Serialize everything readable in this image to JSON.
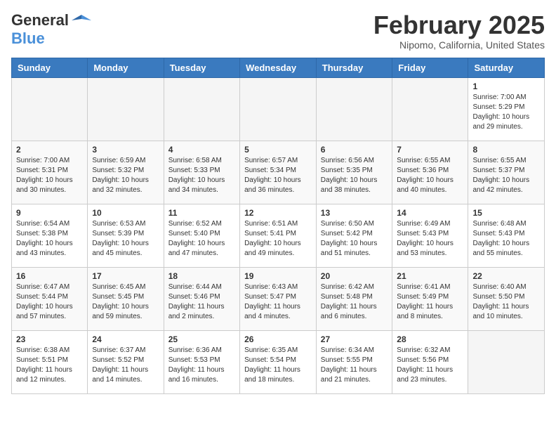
{
  "header": {
    "logo_general": "General",
    "logo_blue": "Blue",
    "month_title": "February 2025",
    "location": "Nipomo, California, United States"
  },
  "weekdays": [
    "Sunday",
    "Monday",
    "Tuesday",
    "Wednesday",
    "Thursday",
    "Friday",
    "Saturday"
  ],
  "weeks": [
    [
      {
        "day": "",
        "info": ""
      },
      {
        "day": "",
        "info": ""
      },
      {
        "day": "",
        "info": ""
      },
      {
        "day": "",
        "info": ""
      },
      {
        "day": "",
        "info": ""
      },
      {
        "day": "",
        "info": ""
      },
      {
        "day": "1",
        "info": "Sunrise: 7:00 AM\nSunset: 5:29 PM\nDaylight: 10 hours and 29 minutes."
      }
    ],
    [
      {
        "day": "2",
        "info": "Sunrise: 7:00 AM\nSunset: 5:31 PM\nDaylight: 10 hours and 30 minutes."
      },
      {
        "day": "3",
        "info": "Sunrise: 6:59 AM\nSunset: 5:32 PM\nDaylight: 10 hours and 32 minutes."
      },
      {
        "day": "4",
        "info": "Sunrise: 6:58 AM\nSunset: 5:33 PM\nDaylight: 10 hours and 34 minutes."
      },
      {
        "day": "5",
        "info": "Sunrise: 6:57 AM\nSunset: 5:34 PM\nDaylight: 10 hours and 36 minutes."
      },
      {
        "day": "6",
        "info": "Sunrise: 6:56 AM\nSunset: 5:35 PM\nDaylight: 10 hours and 38 minutes."
      },
      {
        "day": "7",
        "info": "Sunrise: 6:55 AM\nSunset: 5:36 PM\nDaylight: 10 hours and 40 minutes."
      },
      {
        "day": "8",
        "info": "Sunrise: 6:55 AM\nSunset: 5:37 PM\nDaylight: 10 hours and 42 minutes."
      }
    ],
    [
      {
        "day": "9",
        "info": "Sunrise: 6:54 AM\nSunset: 5:38 PM\nDaylight: 10 hours and 43 minutes."
      },
      {
        "day": "10",
        "info": "Sunrise: 6:53 AM\nSunset: 5:39 PM\nDaylight: 10 hours and 45 minutes."
      },
      {
        "day": "11",
        "info": "Sunrise: 6:52 AM\nSunset: 5:40 PM\nDaylight: 10 hours and 47 minutes."
      },
      {
        "day": "12",
        "info": "Sunrise: 6:51 AM\nSunset: 5:41 PM\nDaylight: 10 hours and 49 minutes."
      },
      {
        "day": "13",
        "info": "Sunrise: 6:50 AM\nSunset: 5:42 PM\nDaylight: 10 hours and 51 minutes."
      },
      {
        "day": "14",
        "info": "Sunrise: 6:49 AM\nSunset: 5:43 PM\nDaylight: 10 hours and 53 minutes."
      },
      {
        "day": "15",
        "info": "Sunrise: 6:48 AM\nSunset: 5:43 PM\nDaylight: 10 hours and 55 minutes."
      }
    ],
    [
      {
        "day": "16",
        "info": "Sunrise: 6:47 AM\nSunset: 5:44 PM\nDaylight: 10 hours and 57 minutes."
      },
      {
        "day": "17",
        "info": "Sunrise: 6:45 AM\nSunset: 5:45 PM\nDaylight: 10 hours and 59 minutes."
      },
      {
        "day": "18",
        "info": "Sunrise: 6:44 AM\nSunset: 5:46 PM\nDaylight: 11 hours and 2 minutes."
      },
      {
        "day": "19",
        "info": "Sunrise: 6:43 AM\nSunset: 5:47 PM\nDaylight: 11 hours and 4 minutes."
      },
      {
        "day": "20",
        "info": "Sunrise: 6:42 AM\nSunset: 5:48 PM\nDaylight: 11 hours and 6 minutes."
      },
      {
        "day": "21",
        "info": "Sunrise: 6:41 AM\nSunset: 5:49 PM\nDaylight: 11 hours and 8 minutes."
      },
      {
        "day": "22",
        "info": "Sunrise: 6:40 AM\nSunset: 5:50 PM\nDaylight: 11 hours and 10 minutes."
      }
    ],
    [
      {
        "day": "23",
        "info": "Sunrise: 6:38 AM\nSunset: 5:51 PM\nDaylight: 11 hours and 12 minutes."
      },
      {
        "day": "24",
        "info": "Sunrise: 6:37 AM\nSunset: 5:52 PM\nDaylight: 11 hours and 14 minutes."
      },
      {
        "day": "25",
        "info": "Sunrise: 6:36 AM\nSunset: 5:53 PM\nDaylight: 11 hours and 16 minutes."
      },
      {
        "day": "26",
        "info": "Sunrise: 6:35 AM\nSunset: 5:54 PM\nDaylight: 11 hours and 18 minutes."
      },
      {
        "day": "27",
        "info": "Sunrise: 6:34 AM\nSunset: 5:55 PM\nDaylight: 11 hours and 21 minutes."
      },
      {
        "day": "28",
        "info": "Sunrise: 6:32 AM\nSunset: 5:56 PM\nDaylight: 11 hours and 23 minutes."
      },
      {
        "day": "",
        "info": ""
      }
    ]
  ]
}
